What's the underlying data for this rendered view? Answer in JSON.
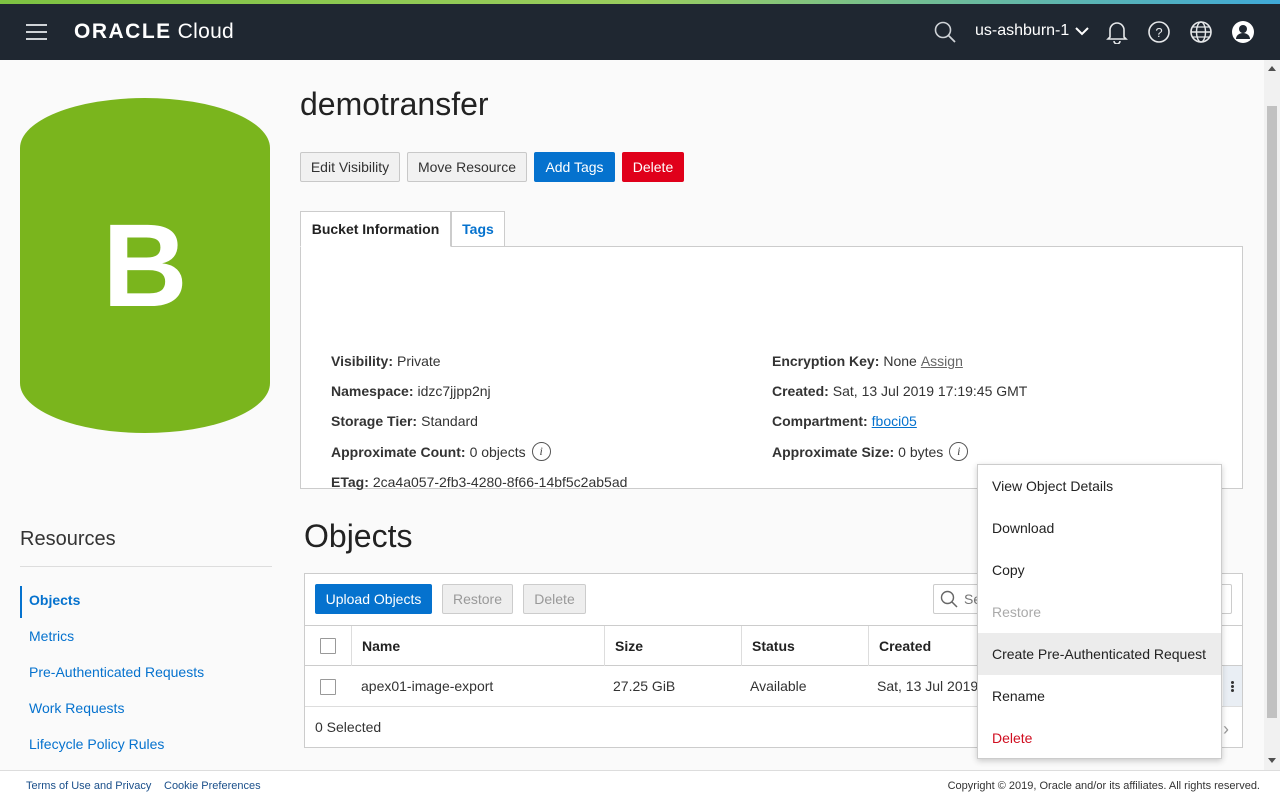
{
  "topbar": {
    "brand_primary": "ORACLE",
    "brand_secondary": "Cloud",
    "region": "us-ashburn-1",
    "icons": [
      "menu-icon",
      "search-icon",
      "chevron-down-icon",
      "bell-icon",
      "help-icon",
      "globe-icon",
      "user-icon"
    ],
    "accent_colors": [
      "#7dc242",
      "#3fa9d8"
    ]
  },
  "bucket": {
    "logo_letter": "B",
    "logo_color": "#7ab51d",
    "name": "demotransfer"
  },
  "actions": {
    "edit_visibility": "Edit Visibility",
    "move_resource": "Move Resource",
    "add_tags": "Add Tags",
    "delete": "Delete"
  },
  "tabs": {
    "bucket_info": "Bucket Information",
    "tags": "Tags"
  },
  "info": {
    "visibility": {
      "key": "Visibility:",
      "value": "Private"
    },
    "namespace": {
      "key": "Namespace:",
      "value": "idzc7jjpp2nj"
    },
    "storage_tier": {
      "key": "Storage Tier:",
      "value": "Standard"
    },
    "approx_count": {
      "key": "Approximate Count:",
      "value": "0 objects"
    },
    "etag": {
      "key": "ETag:",
      "value": "2ca4a057-2fb3-4280-8f66-14bf5c2ab5ad"
    },
    "encryption_key": {
      "key": "Encryption Key:",
      "value": "None",
      "link": "Assign"
    },
    "created": {
      "key": "Created:",
      "value": "Sat, 13 Jul 2019 17:19:45 GMT"
    },
    "compartment": {
      "key": "Compartment:",
      "link": "fboci05"
    },
    "approx_size": {
      "key": "Approximate Size:",
      "value": "0 bytes"
    },
    "info_glyph": "i"
  },
  "resources": {
    "title": "Resources",
    "items": [
      "Objects",
      "Metrics",
      "Pre-Authenticated Requests",
      "Work Requests",
      "Lifecycle Policy Rules"
    ]
  },
  "objects": {
    "title": "Objects",
    "upload": "Upload Objects",
    "restore": "Restore",
    "delete": "Delete",
    "search_placeholder": "Search",
    "columns": [
      "Name",
      "Size",
      "Status",
      "Created"
    ],
    "rows": [
      {
        "name": "apex01-image-export",
        "size": "27.25 GiB",
        "status": "Available",
        "created": "Sat, 13 Jul 2019"
      }
    ],
    "selected": "0 Selected",
    "next_arrow": "›"
  },
  "context_menu": {
    "items": [
      {
        "label": "View Object Details",
        "state": "normal"
      },
      {
        "label": "Download",
        "state": "normal"
      },
      {
        "label": "Copy",
        "state": "normal"
      },
      {
        "label": "Restore",
        "state": "disabled"
      },
      {
        "label": "Create Pre-Authenticated Request",
        "state": "hover"
      },
      {
        "label": "Rename",
        "state": "normal"
      },
      {
        "label": "Delete",
        "state": "danger"
      }
    ]
  },
  "footer": {
    "terms": "Terms of Use and Privacy",
    "cookies": "Cookie Preferences",
    "copyright": "Copyright © 2019, Oracle and/or its affiliates. All rights reserved."
  }
}
